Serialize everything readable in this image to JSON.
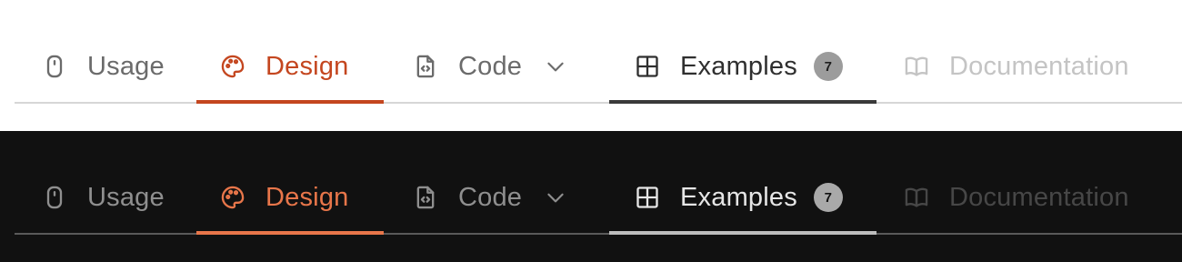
{
  "themes": [
    {
      "name": "light",
      "tabs": {
        "usage": {
          "label": "Usage",
          "icon": "mouse-icon"
        },
        "design": {
          "label": "Design",
          "icon": "palette-icon",
          "state": "selected"
        },
        "code": {
          "label": "Code",
          "icon": "code-file-icon",
          "dropdown": "chevron-down-icon"
        },
        "examples": {
          "label": "Examples",
          "icon": "table-icon",
          "badge": "7",
          "state": "active"
        },
        "documentation": {
          "label": "Documentation",
          "icon": "book-icon",
          "state": "disabled"
        }
      }
    },
    {
      "name": "dark",
      "tabs": {
        "usage": {
          "label": "Usage",
          "icon": "mouse-icon"
        },
        "design": {
          "label": "Design",
          "icon": "palette-icon",
          "state": "selected"
        },
        "code": {
          "label": "Code",
          "icon": "code-file-icon",
          "dropdown": "chevron-down-icon"
        },
        "examples": {
          "label": "Examples",
          "icon": "table-icon",
          "badge": "7",
          "state": "active"
        },
        "documentation": {
          "label": "Documentation",
          "icon": "book-icon",
          "state": "disabled"
        }
      }
    }
  ],
  "colors": {
    "light_accent": "#c4461f",
    "dark_accent": "#e8764a",
    "light_background": "#ffffff",
    "dark_background": "#111111"
  }
}
